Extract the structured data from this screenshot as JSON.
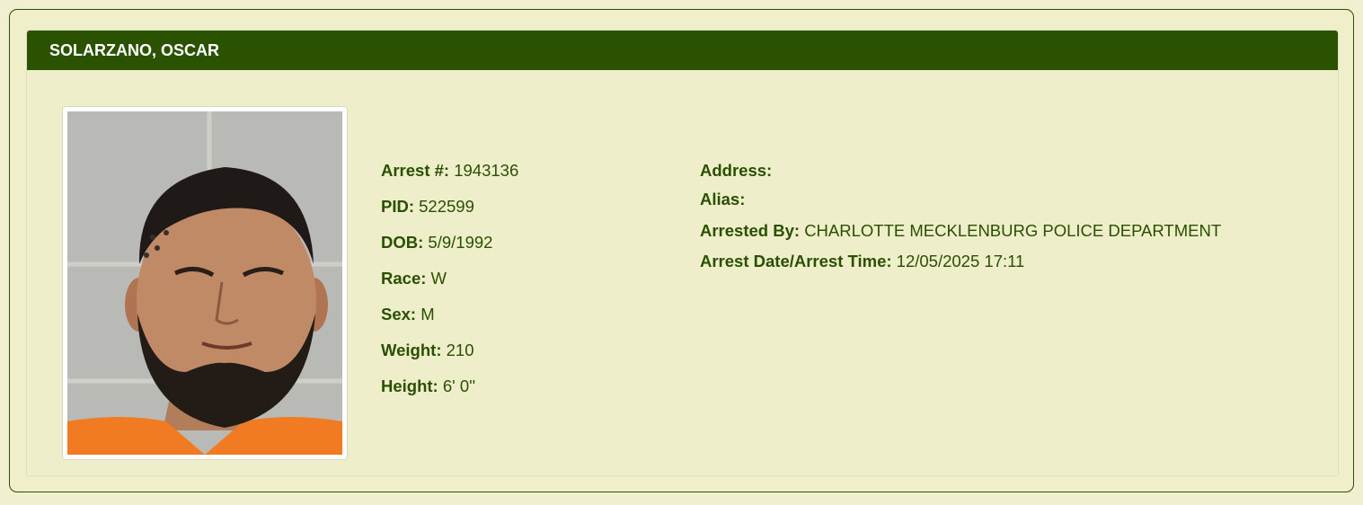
{
  "record": {
    "name": "SOLARZANO, OSCAR"
  },
  "photo": {
    "alt": "Mugshot of SOLARZANO, OSCAR"
  },
  "details_left": [
    {
      "label": "Arrest #:",
      "value": "1943136"
    },
    {
      "label": "PID:",
      "value": "522599"
    },
    {
      "label": "DOB:",
      "value": "5/9/1992"
    },
    {
      "label": "Race:",
      "value": "W"
    },
    {
      "label": "Sex:",
      "value": "M"
    },
    {
      "label": "Weight:",
      "value": "210"
    },
    {
      "label": "Height:",
      "value": "6' 0''"
    }
  ],
  "details_right": [
    {
      "label": "Address:",
      "value": ""
    },
    {
      "label": "Alias:",
      "value": ""
    },
    {
      "label": "Arrested By:",
      "value": "CHARLOTTE MECKLENBURG POLICE DEPARTMENT"
    },
    {
      "label": "Arrest Date/Arrest Time:",
      "value": "12/05/2025 17:11"
    }
  ],
  "colors": {
    "header_bg": "#2b5200",
    "page_bg": "#f0efcf",
    "text": "#2b4f00"
  }
}
